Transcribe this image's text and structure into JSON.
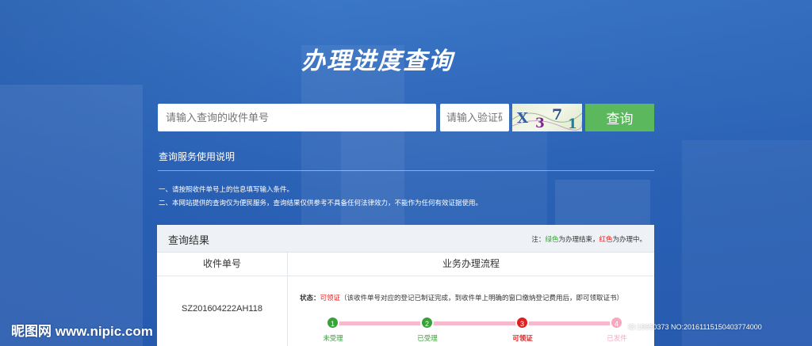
{
  "title": "办理进度查询",
  "search": {
    "placeholder": "请输入查询的收件单号",
    "captcha_placeholder": "请输入验证码",
    "captcha_text": "X371",
    "button_label": "查询"
  },
  "instructions": {
    "title": "查询服务使用说明",
    "lines": [
      "一、请按照收件单号上的信息填写输入条件。",
      "二、本网站提供的查询仅为便民服务，查询结果仅供参考不具备任何法律效力，不能作为任何有效证据使用。"
    ]
  },
  "result": {
    "title": "查询结果",
    "note_prefix": "注：",
    "note_green": "绿色",
    "note_mid": "为办理结束，",
    "note_red": "红色",
    "note_suffix": "为办理中。",
    "col_receipt": "收件单号",
    "col_process": "业务办理流程",
    "receipt_no": "SZ201604222AH118",
    "status_label": "状态：",
    "status_value": "可领证",
    "status_desc": "（该收件单号对应的登记已制证完成，到收件单上明确的窗口缴纳登记费用后，即可领取证书）",
    "steps": [
      {
        "num": "1",
        "label": "未受理",
        "state": "done"
      },
      {
        "num": "2",
        "label": "已受理",
        "state": "done"
      },
      {
        "num": "3",
        "label": "可领证",
        "state": "current"
      },
      {
        "num": "4",
        "label": "已发件",
        "state": "pending"
      }
    ]
  },
  "watermark": {
    "left": "昵图网 www.nipic.com",
    "right": "ID:19650373 NO:20161115150403774000"
  },
  "colors": {
    "done": "#3aa03a",
    "current": "#e02020",
    "pending": "#f7a8bf",
    "track": "#f7b9cb",
    "button": "#5cb85c"
  }
}
